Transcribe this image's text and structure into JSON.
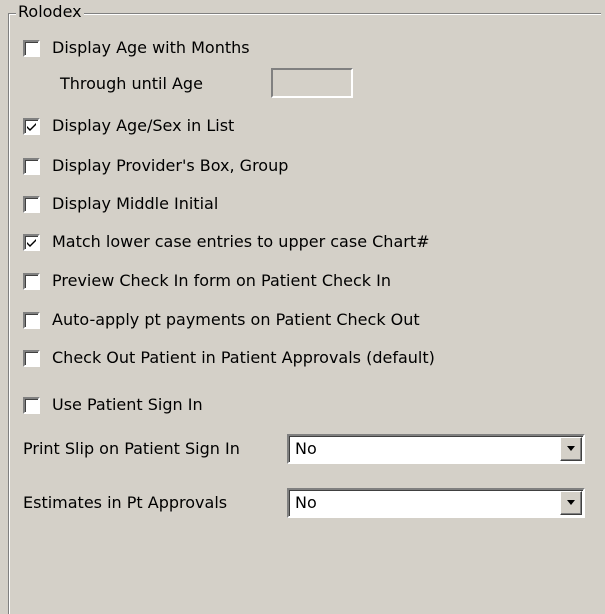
{
  "group": {
    "title": "Rolodex"
  },
  "options": {
    "display_age_months": {
      "label": "Display Age with Months",
      "checked": false
    },
    "through_until_age": {
      "label": "Through until Age",
      "value": ""
    },
    "display_age_sex": {
      "label": "Display Age/Sex in List",
      "checked": true
    },
    "display_provider_box": {
      "label": "Display Provider's Box, Group",
      "checked": false
    },
    "display_middle_initial": {
      "label": "Display Middle Initial",
      "checked": false
    },
    "match_lower_case": {
      "label": "Match lower case entries to upper case Chart#",
      "checked": true
    },
    "preview_check_in": {
      "label": "Preview Check In form on Patient Check In",
      "checked": false
    },
    "auto_apply_payments": {
      "label": "Auto-apply pt payments on Patient Check Out",
      "checked": false
    },
    "check_out_approvals": {
      "label": "Check Out Patient in Patient Approvals (default)",
      "checked": false
    },
    "use_patient_sign_in": {
      "label": "Use Patient Sign In",
      "checked": false
    }
  },
  "selects": {
    "print_slip": {
      "label": "Print Slip on Patient Sign In",
      "value": "No"
    },
    "estimates": {
      "label": "Estimates in Pt Approvals",
      "value": "No"
    }
  },
  "icons": {
    "check": "check-mark-icon",
    "dropdown": "chevron-down-icon"
  }
}
